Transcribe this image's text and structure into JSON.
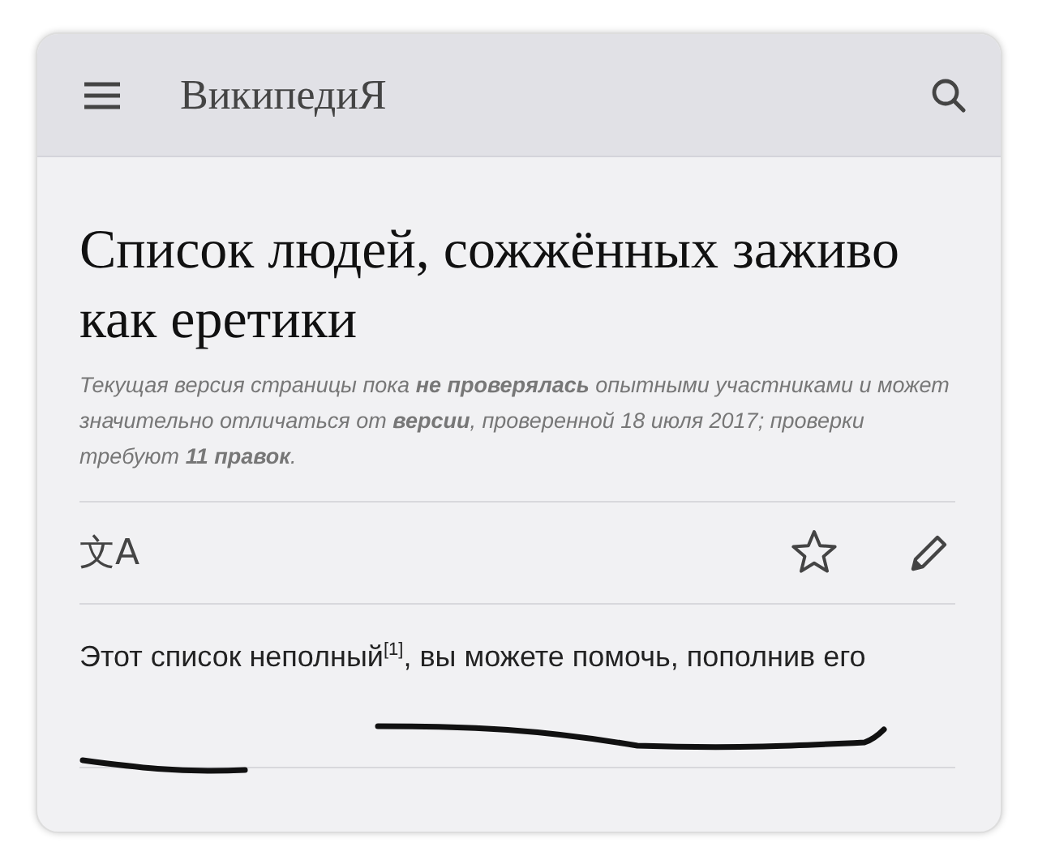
{
  "header": {
    "logo": "ВикипедиЯ"
  },
  "article": {
    "title": "Список людей, сожжённых заживо как еретики",
    "notice": "Текущая версия страницы пока **не проверялась** опытными участниками и может значительно отличаться от **версии**, проверенной 18 июля 2017; проверки требуют **11 правок**."
  },
  "actions": {
    "language_icon": "文A"
  },
  "content": {
    "paragraph": "Этот список неполный$^{[1]}$, вы можете помочь, пополнив его"
  }
}
